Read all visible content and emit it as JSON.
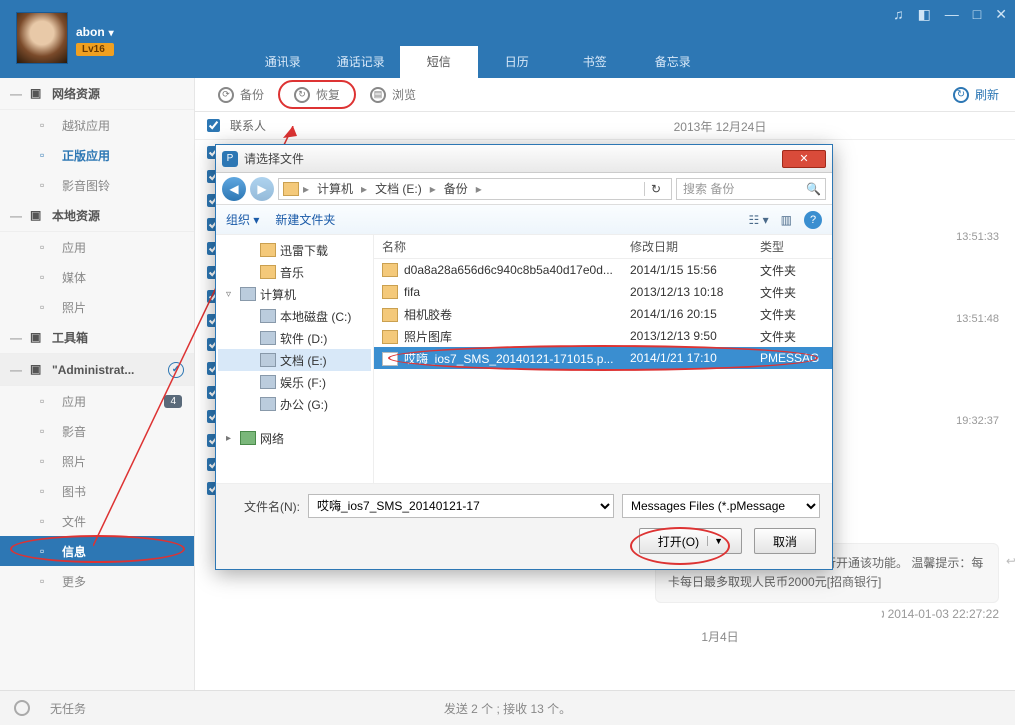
{
  "header": {
    "username": "abon",
    "level_badge": "Lv16",
    "tabs": [
      "通讯录",
      "通话记录",
      "短信",
      "日历",
      "书签",
      "备忘录"
    ],
    "active_tab_index": 2,
    "win_icons": [
      "music-icon",
      "skin-icon",
      "minimize-icon",
      "maximize-icon",
      "close-icon"
    ]
  },
  "toolbar": {
    "backup": "备份",
    "restore": "恢复",
    "browse": "浏览",
    "refresh": "刷新"
  },
  "sidebar": {
    "groups": [
      {
        "title": "网络资源",
        "items": [
          {
            "label": "越狱应用",
            "icon": "store-icon"
          },
          {
            "label": "正版应用",
            "icon": "download-icon",
            "active": true
          },
          {
            "label": "影音图铃",
            "icon": "music-icon"
          }
        ]
      },
      {
        "title": "本地资源",
        "items": [
          {
            "label": "应用",
            "icon": "grid-icon"
          },
          {
            "label": "媒体",
            "icon": "media-icon"
          },
          {
            "label": "照片",
            "icon": "photo-icon"
          }
        ]
      },
      {
        "title": "工具箱",
        "items": []
      },
      {
        "title": "\"Administrat...",
        "admin": true,
        "items": [
          {
            "label": "应用",
            "icon": "grid-icon",
            "count": "4"
          },
          {
            "label": "影音",
            "icon": "media-icon"
          },
          {
            "label": "照片",
            "icon": "photo-icon"
          },
          {
            "label": "图书",
            "icon": "book-icon"
          },
          {
            "label": "文件",
            "icon": "file-icon"
          },
          {
            "label": "信息",
            "icon": "chat-icon",
            "info": true
          },
          {
            "label": "更多",
            "icon": "more-icon"
          }
        ]
      }
    ]
  },
  "contacts": {
    "header": "联系人"
  },
  "messages": {
    "date1": "2013年 12月24日",
    "time1": "13:51:33",
    "time2": "13:51:48",
    "time3": "19:32:37",
    "body": "，请登录信用卡网站或手机银行开通该功能。 温馨提示：每卡每日最多取现人民币2000元[招商银行]",
    "time4": "2014-01-03 22:27:22",
    "date2": "1月4日"
  },
  "status": {
    "no_task": "无任务",
    "center": "发送 2 个 ; 接收 13 个。"
  },
  "dialog": {
    "title": "请选择文件",
    "crumbs": [
      "计算机",
      "文档 (E:)",
      "备份"
    ],
    "search_placeholder": "搜索 备份",
    "organize": "组织",
    "new_folder": "新建文件夹",
    "tree": [
      {
        "label": "迅雷下载",
        "icon": "folder",
        "lvl": 2
      },
      {
        "label": "音乐",
        "icon": "folder",
        "lvl": 2
      },
      {
        "label": "计算机",
        "icon": "pc",
        "lvl": 1,
        "expand": "▿"
      },
      {
        "label": "本地磁盘 (C:)",
        "icon": "drive",
        "lvl": 2
      },
      {
        "label": "软件 (D:)",
        "icon": "drive",
        "lvl": 2
      },
      {
        "label": "文档 (E:)",
        "icon": "drive",
        "lvl": 2,
        "sel": true
      },
      {
        "label": "娱乐 (F:)",
        "icon": "drive",
        "lvl": 2
      },
      {
        "label": "办公 (G:)",
        "icon": "drive",
        "lvl": 2
      },
      {
        "label": "网络",
        "icon": "net",
        "lvl": 1,
        "expand": "▸"
      }
    ],
    "columns": {
      "name": "名称",
      "date": "修改日期",
      "type": "类型"
    },
    "rows": [
      {
        "name": "d0a8a28a656d6c940c8b5a40d17e0d...",
        "date": "2014/1/15 15:56",
        "type": "文件夹"
      },
      {
        "name": "fifa",
        "date": "2013/12/13 10:18",
        "type": "文件夹"
      },
      {
        "name": "相机胶卷",
        "date": "2014/1/16 20:15",
        "type": "文件夹"
      },
      {
        "name": "照片图库",
        "date": "2013/12/13 9:50",
        "type": "文件夹"
      },
      {
        "name": "哎嗨_ios7_SMS_20140121-171015.p...",
        "date": "2014/1/21 17:10",
        "type": "PMESSAG",
        "sel": true,
        "file": true
      }
    ],
    "filename_label": "文件名(N):",
    "filename_value": "哎嗨_ios7_SMS_20140121-17",
    "filter": "Messages Files (*.pMessage",
    "open": "打开(O)",
    "cancel": "取消"
  }
}
